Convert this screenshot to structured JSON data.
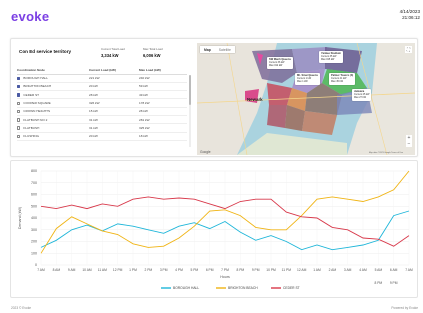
{
  "header": {
    "logo_ev": "ev",
    "logo_rest": "oke",
    "date": "4/14/2023",
    "time": "21:06:12"
  },
  "territory_card": {
    "title": "Con Ed service territory",
    "metrics": [
      {
        "label": "Current Total Load",
        "value": "3,334 kW"
      },
      {
        "label": "Max Total Load",
        "value": "6,006 kW"
      }
    ],
    "columns": [
      "Coordination Node",
      "Current Load (kW)",
      "Max Load (kW)"
    ],
    "rows": [
      {
        "checked": true,
        "name": "BOROUGH HALL",
        "current": "221 kW",
        "max": "240 kW"
      },
      {
        "checked": true,
        "name": "BRIGHTON BEACH",
        "current": "20 kW",
        "max": "59 kW"
      },
      {
        "checked": true,
        "name": "CEDER ST",
        "current": "28 kW",
        "max": "49 kW"
      },
      {
        "checked": false,
        "name": "COOPER SQUARE",
        "current": "326 kW",
        "max": "178 kW"
      },
      {
        "checked": false,
        "name": "CROWN HEIGHTS",
        "current": "15 kW",
        "max": "28 kW"
      },
      {
        "checked": false,
        "name": "FLATBUSH NO 2",
        "current": "31 kW",
        "max": "281 kW"
      },
      {
        "checked": false,
        "name": "FLATBUSH",
        "current": "31 kW",
        "max": "325 kW"
      },
      {
        "checked": false,
        "name": "FLUSHING",
        "current": "20 kW",
        "max": "18 kW"
      }
    ]
  },
  "map": {
    "tab_map": "Map",
    "tab_satellite": "Satellite",
    "fullscreen_icon": "fullscreen-icon",
    "city_label": "Newark",
    "google_label": "Google",
    "terms": "Map data ©2023 Google   Terms of Use",
    "tooltip_1": {
      "title": "SW Manh Queens",
      "l1": "Current",
      "l2": "Max",
      "v1": "36 kW",
      "v2": "192 kW"
    },
    "tooltip_2": {
      "title": "Mt. Sinai Queens",
      "l1": "Current",
      "l2": "Max",
      "v1": "1 kW",
      "v2": "1 kW"
    },
    "tooltip_3": {
      "title": "Yankee Stadium",
      "l1": "Current",
      "l2": "Max",
      "v1": "35 kW",
      "v2": "195 kW"
    },
    "tooltip_4": {
      "title": "Palmer Towers (3)",
      "l1": "Current",
      "l2": "Max",
      "v1": "41 kW",
      "v2": "45 kW"
    },
    "tooltip_5": {
      "title": "Jamaica",
      "l1": "Current",
      "l2": "Max",
      "v1": "25 kW",
      "v2": "27 kW"
    }
  },
  "chart_data": {
    "type": "line",
    "ylabel": "Demand (kW)",
    "xlabel": "Hours",
    "ylim": [
      0,
      800
    ],
    "yticks": [
      0,
      100,
      200,
      300,
      400,
      500,
      600,
      700,
      800
    ],
    "xticks": [
      "7 AM",
      "8 AM",
      "9 AM",
      "10 AM",
      "11 AM",
      "12 PM",
      "1 PM",
      "2 PM",
      "3 PM",
      "4 PM",
      "5 PM",
      "6 PM",
      "7 PM",
      "8 PM",
      "9 PM",
      "10 PM",
      "11 PM",
      "12 AM",
      "1 AM",
      "2 AM",
      "3 AM",
      "4 AM",
      "5 AM",
      "6 AM",
      "7 AM"
    ],
    "xticks_row2": [
      "8 PM",
      "9 PM"
    ],
    "grid": true,
    "legend_position": "bottom",
    "series": [
      {
        "name": "BOROUGH HALL",
        "color": "#1fb6d9",
        "values": [
          150,
          210,
          300,
          340,
          290,
          350,
          330,
          300,
          270,
          330,
          360,
          310,
          370,
          280,
          210,
          250,
          200,
          130,
          170,
          130,
          150,
          170,
          210,
          420,
          460
        ]
      },
      {
        "name": "BRIGHTON BEACH",
        "color": "#f0b414",
        "values": [
          100,
          310,
          410,
          350,
          290,
          260,
          180,
          150,
          160,
          230,
          330,
          460,
          470,
          420,
          320,
          300,
          300,
          420,
          560,
          580,
          560,
          540,
          580,
          640,
          800
        ]
      },
      {
        "name": "CEDER ST",
        "color": "#d8384a",
        "values": [
          500,
          480,
          510,
          480,
          520,
          500,
          560,
          580,
          560,
          570,
          560,
          520,
          480,
          540,
          560,
          560,
          450,
          410,
          400,
          320,
          300,
          230,
          220,
          160,
          250
        ]
      }
    ]
  },
  "footer": {
    "left": "2023 © Evoke",
    "right": "Powered by Evoke"
  }
}
